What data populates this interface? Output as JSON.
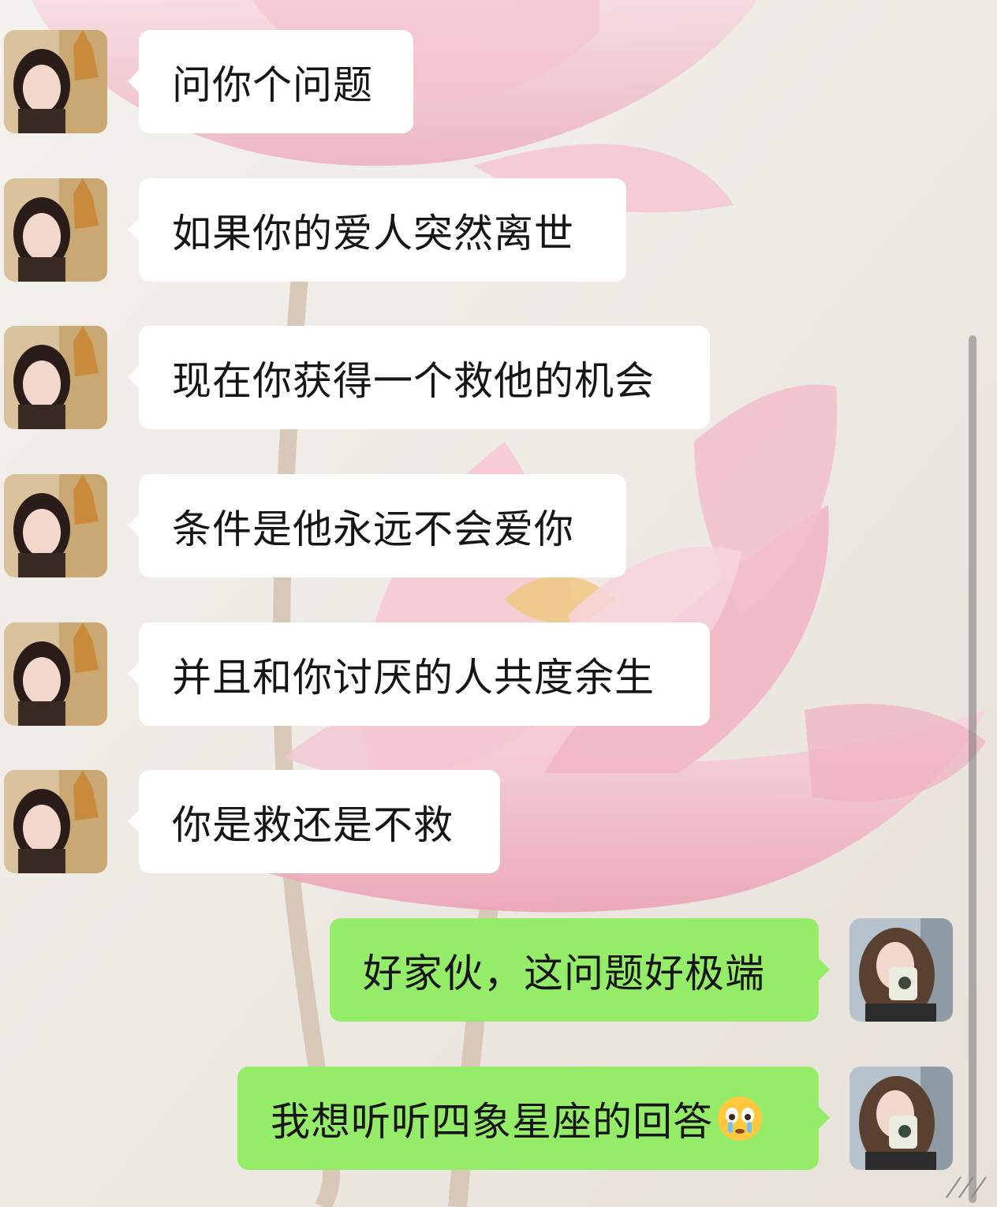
{
  "chat": {
    "messages": [
      {
        "side": "left",
        "text": "问你个问题"
      },
      {
        "side": "left",
        "text": "如果你的爱人突然离世"
      },
      {
        "side": "left",
        "text": "现在你获得一个救他的机会"
      },
      {
        "side": "left",
        "text": "条件是他永远不会爱你"
      },
      {
        "side": "left",
        "text": "并且和你讨厌的人共度余生"
      },
      {
        "side": "left",
        "text": "你是救还是不救"
      },
      {
        "side": "right",
        "text": "好家伙，这问题好极端"
      },
      {
        "side": "right",
        "text": "我想听听四象星座的回答",
        "emoji": "crying-eyes-emoji"
      }
    ]
  },
  "colors": {
    "left_bubble": "#ffffff",
    "right_bubble": "#95ec69",
    "background": "#ece8e2",
    "lotus": "#f1b9c6"
  },
  "icons": {
    "scroll_indicator": "scrollbar",
    "home": "home-indicator-icon"
  }
}
